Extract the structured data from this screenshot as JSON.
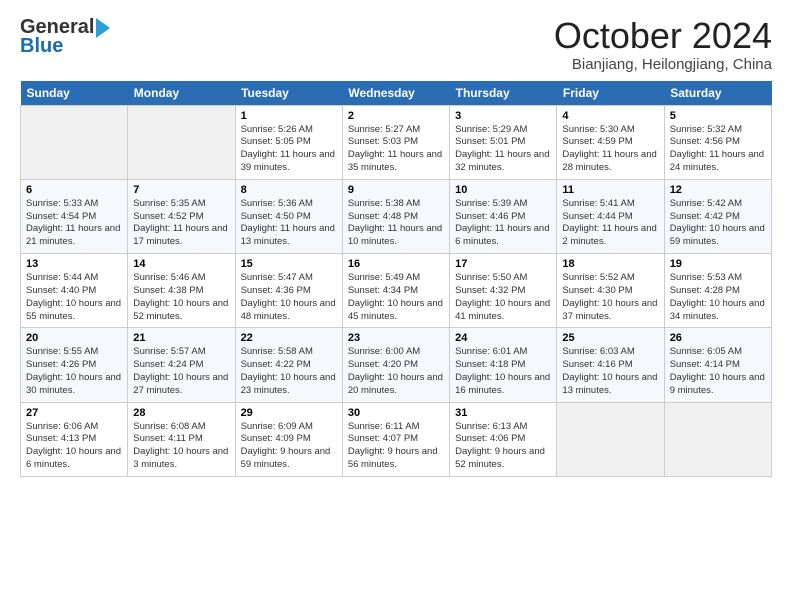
{
  "header": {
    "logo_general": "General",
    "logo_blue": "Blue",
    "month": "October 2024",
    "location": "Bianjiang, Heilongjiang, China"
  },
  "days_of_week": [
    "Sunday",
    "Monday",
    "Tuesday",
    "Wednesday",
    "Thursday",
    "Friday",
    "Saturday"
  ],
  "weeks": [
    [
      {
        "day": "",
        "empty": true
      },
      {
        "day": "",
        "empty": true
      },
      {
        "day": "1",
        "sunrise": "5:26 AM",
        "sunset": "5:05 PM",
        "daylight": "11 hours and 39 minutes."
      },
      {
        "day": "2",
        "sunrise": "5:27 AM",
        "sunset": "5:03 PM",
        "daylight": "11 hours and 35 minutes."
      },
      {
        "day": "3",
        "sunrise": "5:29 AM",
        "sunset": "5:01 PM",
        "daylight": "11 hours and 32 minutes."
      },
      {
        "day": "4",
        "sunrise": "5:30 AM",
        "sunset": "4:59 PM",
        "daylight": "11 hours and 28 minutes."
      },
      {
        "day": "5",
        "sunrise": "5:32 AM",
        "sunset": "4:56 PM",
        "daylight": "11 hours and 24 minutes."
      }
    ],
    [
      {
        "day": "6",
        "sunrise": "5:33 AM",
        "sunset": "4:54 PM",
        "daylight": "11 hours and 21 minutes."
      },
      {
        "day": "7",
        "sunrise": "5:35 AM",
        "sunset": "4:52 PM",
        "daylight": "11 hours and 17 minutes."
      },
      {
        "day": "8",
        "sunrise": "5:36 AM",
        "sunset": "4:50 PM",
        "daylight": "11 hours and 13 minutes."
      },
      {
        "day": "9",
        "sunrise": "5:38 AM",
        "sunset": "4:48 PM",
        "daylight": "11 hours and 10 minutes."
      },
      {
        "day": "10",
        "sunrise": "5:39 AM",
        "sunset": "4:46 PM",
        "daylight": "11 hours and 6 minutes."
      },
      {
        "day": "11",
        "sunrise": "5:41 AM",
        "sunset": "4:44 PM",
        "daylight": "11 hours and 2 minutes."
      },
      {
        "day": "12",
        "sunrise": "5:42 AM",
        "sunset": "4:42 PM",
        "daylight": "10 hours and 59 minutes."
      }
    ],
    [
      {
        "day": "13",
        "sunrise": "5:44 AM",
        "sunset": "4:40 PM",
        "daylight": "10 hours and 55 minutes."
      },
      {
        "day": "14",
        "sunrise": "5:46 AM",
        "sunset": "4:38 PM",
        "daylight": "10 hours and 52 minutes."
      },
      {
        "day": "15",
        "sunrise": "5:47 AM",
        "sunset": "4:36 PM",
        "daylight": "10 hours and 48 minutes."
      },
      {
        "day": "16",
        "sunrise": "5:49 AM",
        "sunset": "4:34 PM",
        "daylight": "10 hours and 45 minutes."
      },
      {
        "day": "17",
        "sunrise": "5:50 AM",
        "sunset": "4:32 PM",
        "daylight": "10 hours and 41 minutes."
      },
      {
        "day": "18",
        "sunrise": "5:52 AM",
        "sunset": "4:30 PM",
        "daylight": "10 hours and 37 minutes."
      },
      {
        "day": "19",
        "sunrise": "5:53 AM",
        "sunset": "4:28 PM",
        "daylight": "10 hours and 34 minutes."
      }
    ],
    [
      {
        "day": "20",
        "sunrise": "5:55 AM",
        "sunset": "4:26 PM",
        "daylight": "10 hours and 30 minutes."
      },
      {
        "day": "21",
        "sunrise": "5:57 AM",
        "sunset": "4:24 PM",
        "daylight": "10 hours and 27 minutes."
      },
      {
        "day": "22",
        "sunrise": "5:58 AM",
        "sunset": "4:22 PM",
        "daylight": "10 hours and 23 minutes."
      },
      {
        "day": "23",
        "sunrise": "6:00 AM",
        "sunset": "4:20 PM",
        "daylight": "10 hours and 20 minutes."
      },
      {
        "day": "24",
        "sunrise": "6:01 AM",
        "sunset": "4:18 PM",
        "daylight": "10 hours and 16 minutes."
      },
      {
        "day": "25",
        "sunrise": "6:03 AM",
        "sunset": "4:16 PM",
        "daylight": "10 hours and 13 minutes."
      },
      {
        "day": "26",
        "sunrise": "6:05 AM",
        "sunset": "4:14 PM",
        "daylight": "10 hours and 9 minutes."
      }
    ],
    [
      {
        "day": "27",
        "sunrise": "6:06 AM",
        "sunset": "4:13 PM",
        "daylight": "10 hours and 6 minutes."
      },
      {
        "day": "28",
        "sunrise": "6:08 AM",
        "sunset": "4:11 PM",
        "daylight": "10 hours and 3 minutes."
      },
      {
        "day": "29",
        "sunrise": "6:09 AM",
        "sunset": "4:09 PM",
        "daylight": "9 hours and 59 minutes."
      },
      {
        "day": "30",
        "sunrise": "6:11 AM",
        "sunset": "4:07 PM",
        "daylight": "9 hours and 56 minutes."
      },
      {
        "day": "31",
        "sunrise": "6:13 AM",
        "sunset": "4:06 PM",
        "daylight": "9 hours and 52 minutes."
      },
      {
        "day": "",
        "empty": true
      },
      {
        "day": "",
        "empty": true
      }
    ]
  ]
}
